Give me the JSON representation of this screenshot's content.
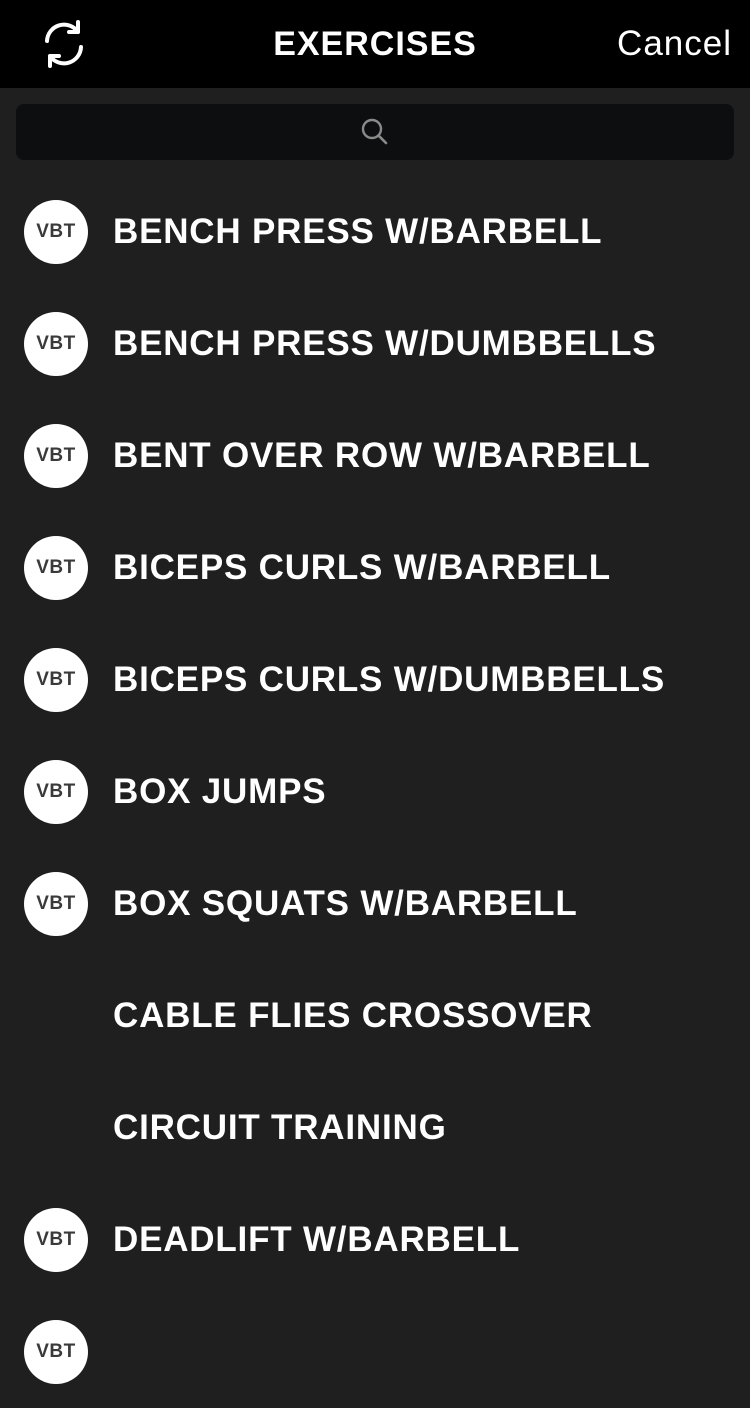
{
  "header": {
    "title": "EXERCISES",
    "cancel_label": "Cancel"
  },
  "search": {
    "placeholder": "",
    "value": ""
  },
  "colors": {
    "nav_background": "#000000",
    "list_background": "#1f1f1f",
    "search_background": "#0d0e0f",
    "badge_background": "#ffffff",
    "badge_text": "#3a3a3a",
    "text": "#ffffff"
  },
  "exercises": [
    {
      "label": "BENCH PRESS W/BARBELL",
      "badge": "VBT"
    },
    {
      "label": "BENCH PRESS W/DUMBBELLS",
      "badge": "VBT"
    },
    {
      "label": "BENT OVER ROW W/BARBELL",
      "badge": "VBT"
    },
    {
      "label": "BICEPS CURLS W/BARBELL",
      "badge": "VBT"
    },
    {
      "label": "BICEPS CURLS W/DUMBBELLS",
      "badge": "VBT"
    },
    {
      "label": "BOX JUMPS",
      "badge": "VBT"
    },
    {
      "label": "BOX SQUATS W/BARBELL",
      "badge": "VBT"
    },
    {
      "label": "CABLE FLIES CROSSOVER",
      "badge": ""
    },
    {
      "label": "CIRCUIT TRAINING",
      "badge": ""
    },
    {
      "label": "DEADLIFT W/BARBELL",
      "badge": "VBT"
    },
    {
      "label": "",
      "badge": "VBT"
    }
  ]
}
